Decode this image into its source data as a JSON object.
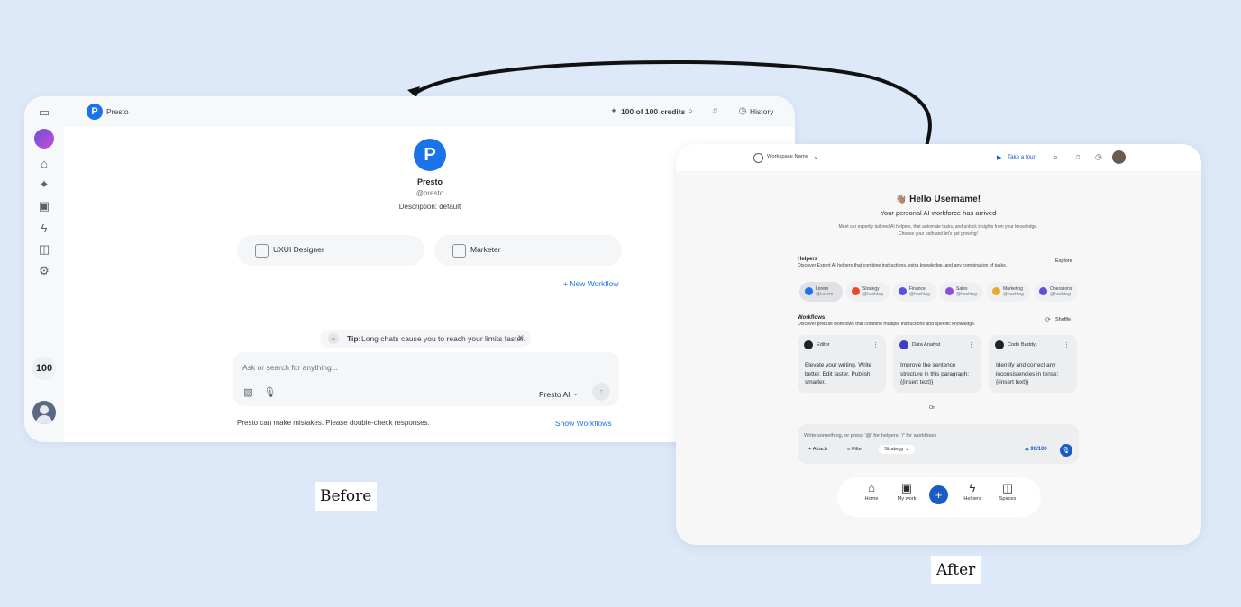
{
  "labels": {
    "before": "Before",
    "after": "After"
  },
  "before": {
    "brand": "Presto",
    "credits": "100 of 100 credits",
    "history": "History",
    "sidebar_count": "100",
    "profile_name": "Presto",
    "profile_handle": "@presto",
    "profile_description": "Description: default",
    "workflows": [
      "UXUI Designer",
      "Marketer"
    ],
    "new_workflow": "+ New Workflow",
    "tip_label": "Tip:",
    "tip_text": "Long chats cause you to reach your limits faster.",
    "input_placeholder": "Ask or search for anything...",
    "model": "Presto AI",
    "disclaimer": "Presto can make mistakes. Please double-check responses.",
    "show_workflows": "Show Workflows",
    "icons": [
      "sidebar-toggle-icon",
      "home-icon",
      "sparkle-icon",
      "calendar-check-icon",
      "lightning-icon",
      "book-icon",
      "gear-icon",
      "search-icon",
      "bell-icon",
      "history-icon",
      "image-icon",
      "mic-icon",
      "send-arrow-icon"
    ]
  },
  "after": {
    "workspace": "Workspace Name",
    "take_tour": "Take a tour",
    "greeting": "👋🏽 Hello Username!",
    "subtitle": "Your personal AI workforce has arrived",
    "intro_line1": "Meet our expertly tailored AI helpers, that automate tasks, and unlock insights from your knowledge.",
    "intro_line2": "Choose your path and let's get growing!",
    "helpers_title": "Helpers",
    "helpers_desc": "Discover Expert AI helpers that combine instructions, extra knowledge, and any combination of tasks.",
    "explore": "Explore",
    "helpers": [
      {
        "name": "Lorem",
        "handle": "@Lorem",
        "color": "#1a73e8"
      },
      {
        "name": "Strategy",
        "handle": "@hashtag",
        "color": "#e8492c"
      },
      {
        "name": "Finance",
        "handle": "@hashtag",
        "color": "#5b4fd6"
      },
      {
        "name": "Sales",
        "handle": "@hashtag",
        "color": "#8a4fd6"
      },
      {
        "name": "Marketing",
        "handle": "@hashtag",
        "color": "#e8a92c"
      },
      {
        "name": "Operations",
        "handle": "@hashtag",
        "color": "#5b4fd6"
      }
    ],
    "workflows_title": "Workflows",
    "workflows_desc": "Discover prebuilt workflows that combine multiple instructions and specific knowledge.",
    "shuffle": "Shuffle",
    "workflow_cards": [
      {
        "name": "Editor",
        "text": "Elevate your writing. Write better. Edit faster. Publish smarter.",
        "color": "#1f2328"
      },
      {
        "name": "Data Analyst",
        "text": "Improve the sentence structure in this paragraph: {{insert text}}",
        "color": "#3b3fc4"
      },
      {
        "name": "Code Buddy..",
        "text": "Identify and correct any inconsistencies in tense: {{insert text}}",
        "color": "#1f2328"
      }
    ],
    "or": "Or",
    "input_placeholder": "Write something, or press '@' for helpers, '/' for workflows",
    "attach": "Attach",
    "filter": "Filter",
    "strategy": "Strategy",
    "credits": "90/100",
    "nav": [
      "Home",
      "My work",
      "Helpers",
      "Spaces"
    ]
  },
  "colors": {
    "accent": "#1a73e8",
    "page_bg": "#dde9f8"
  }
}
